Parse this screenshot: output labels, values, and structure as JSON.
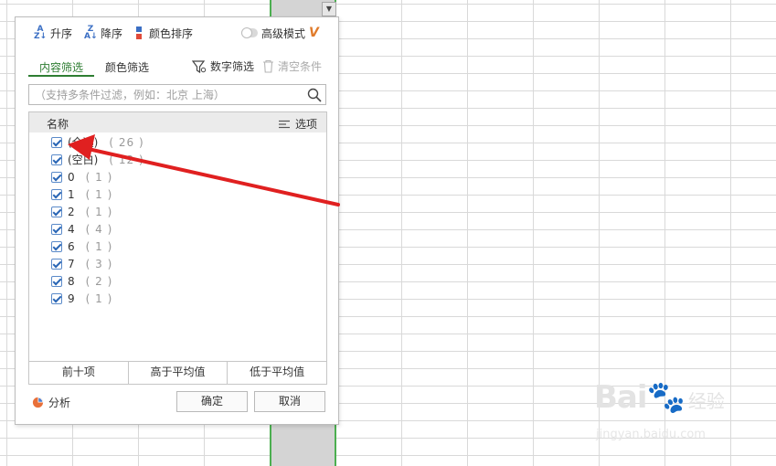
{
  "sort": {
    "asc_label": "升序",
    "desc_label": "降序",
    "color_label": "颜色排序",
    "advanced_label": "高级模式",
    "asc_icon": "sort-ascending-icon",
    "desc_icon": "sort-descending-icon",
    "vip_icon": "V"
  },
  "tabs": {
    "content_label": "内容筛选",
    "color_label": "颜色筛选",
    "number_label": "数字筛选",
    "clear_label": "清空条件"
  },
  "search": {
    "placeholder": "（支持多条件过滤，例如：北京 上海）"
  },
  "list": {
    "header_name": "名称",
    "header_options": "选项",
    "items": [
      {
        "label": "(全选)",
        "count": "( 26 )"
      },
      {
        "label": "(空白)",
        "count": "( 12 )"
      },
      {
        "label": "0",
        "count": "( 1 )"
      },
      {
        "label": "1",
        "count": "( 1 )"
      },
      {
        "label": "2",
        "count": "( 1 )"
      },
      {
        "label": "4",
        "count": "( 4 )"
      },
      {
        "label": "6",
        "count": "( 1 )"
      },
      {
        "label": "7",
        "count": "( 3 )"
      },
      {
        "label": "8",
        "count": "( 2 )"
      },
      {
        "label": "9",
        "count": "( 1 )"
      }
    ]
  },
  "quick_filters": {
    "top10": "前十项",
    "above_avg": "高于平均值",
    "below_avg": "低于平均值"
  },
  "footer": {
    "analyze_label": "分析",
    "ok_label": "确定",
    "cancel_label": "取消"
  },
  "watermark": {
    "main": "Bai",
    "sub": "经验",
    "url": "jingyan.baidu.com"
  },
  "colors": {
    "accent_green": "#2e7d32",
    "selection_border": "#4caf50",
    "annotation_arrow": "#e02020",
    "checkbox_blue": "#2a66b5"
  }
}
